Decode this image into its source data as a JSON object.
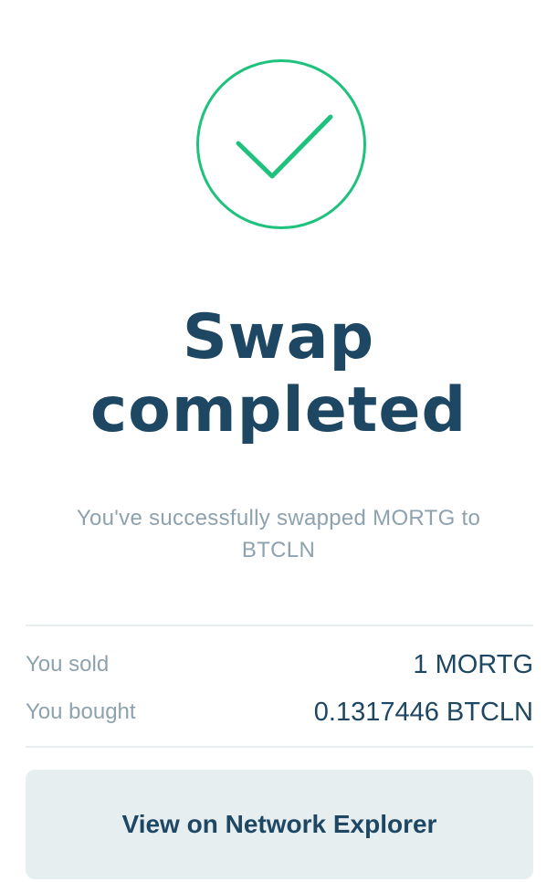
{
  "status_icon": "check-circle-icon",
  "accent_color": "#1fc27d",
  "title": {
    "line1": "Swap",
    "line2": "completed"
  },
  "subtitle": "You've successfully swapped MORTG to BTCLN",
  "summary": {
    "sold_label": "You sold",
    "sold_value": "1 MORTG",
    "bought_label": "You bought",
    "bought_value": "0.1317446 BTCLN"
  },
  "actions": {
    "explorer_label": "View on Network Explorer"
  }
}
